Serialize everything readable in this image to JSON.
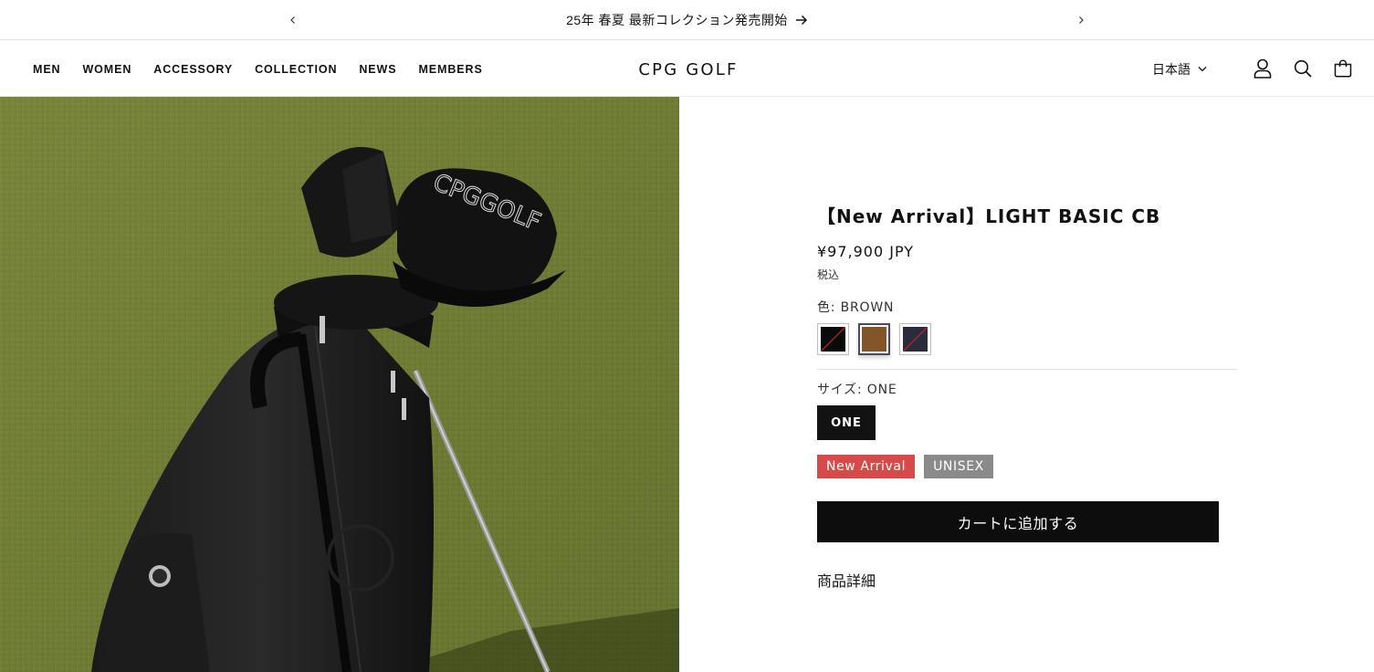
{
  "announcement": {
    "text": "25年 春夏 最新コレクション発売開始"
  },
  "header": {
    "nav": [
      "MEN",
      "WOMEN",
      "ACCESSORY",
      "COLLECTION",
      "NEWS",
      "MEMBERS"
    ],
    "logo": "CPG GOLF",
    "language": "日本語"
  },
  "product": {
    "title": "【New Arrival】LIGHT BASIC CB",
    "price": "¥97,900 JPY",
    "tax_note": "税込",
    "color_label": "色: BROWN",
    "colors": [
      {
        "name": "BLACK",
        "hex": "#0a0a0a",
        "stripe": "#c0262b",
        "selected": false
      },
      {
        "name": "BROWN",
        "hex": "#8a5a2c",
        "stripe": "",
        "selected": true
      },
      {
        "name": "NAVY",
        "hex": "#2a2b3d",
        "stripe": "#c0262b",
        "selected": false
      }
    ],
    "size_label": "サイズ: ONE",
    "size_value": "ONE",
    "badges": [
      "New Arrival",
      "UNISEX"
    ],
    "add_to_cart": "カートに追加する",
    "details_label": "商品詳細"
  },
  "colors": {
    "badge_new": "#d64a4a",
    "badge_unisex": "#8a8a8a",
    "button": "#0d0d0d"
  },
  "icons": [
    "chevron-left-icon",
    "chevron-right-icon",
    "arrow-right-icon",
    "chevron-down-icon",
    "account-icon",
    "search-icon",
    "cart-icon"
  ]
}
